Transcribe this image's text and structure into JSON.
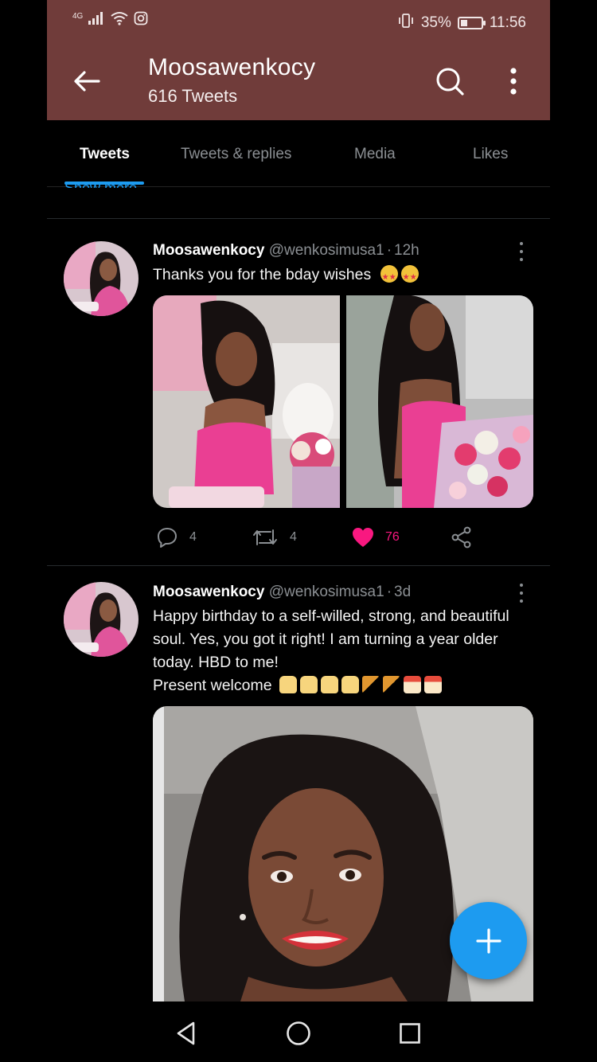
{
  "status_bar": {
    "network": "4G",
    "battery_percent": "35%",
    "battery_level": 0.35,
    "time": "11:56"
  },
  "header": {
    "title": "Moosawenkocy",
    "subtitle": "616 Tweets",
    "background_color": "#703c3a"
  },
  "tabs": [
    {
      "label": "Tweets",
      "active": true
    },
    {
      "label": "Tweets & replies",
      "active": false
    },
    {
      "label": "Media",
      "active": false
    },
    {
      "label": "Likes",
      "active": false
    }
  ],
  "show_more": "Show more",
  "tweets": [
    {
      "name": "Moosawenkocy",
      "handle": "@wenkosimusa1",
      "separator": "·",
      "time": "12h",
      "text": "Thanks you for the bday wishes",
      "emojis": [
        "star-struck-emoji",
        "star-struck-emoji"
      ],
      "media": [
        "photo-pink-dress-with-cake",
        "photo-pink-dress-with-bouquet"
      ],
      "replies": "4",
      "retweets": "4",
      "likes": "76",
      "liked": true
    },
    {
      "name": "Moosawenkocy",
      "handle": "@wenkosimusa1",
      "separator": "·",
      "time": "3d",
      "text_lines": [
        "Happy birthday to a self-willed, strong, and beautiful",
        "soul. Yes, you got it right! I am turning a year older",
        "today. HBD to me!",
        "Present welcome"
      ],
      "emojis": [
        "birthday-cake-emoji",
        "birthday-cake-emoji",
        "birthday-cake-emoji",
        "birthday-cake-emoji",
        "pie-emoji",
        "pie-emoji",
        "shortcake-emoji",
        "shortcake-emoji"
      ],
      "media": [
        "photo-selfie-portrait"
      ]
    }
  ],
  "accent_color": "#1d9bf0",
  "like_color": "#f91880"
}
